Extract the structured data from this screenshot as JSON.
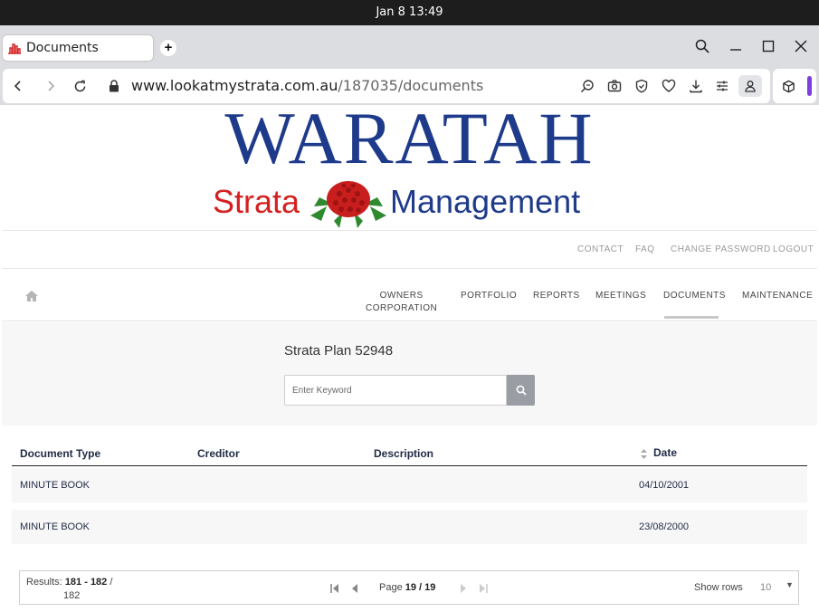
{
  "os": {
    "clock": "Jan 8  13:49"
  },
  "browser": {
    "tab_title": "Documents",
    "url_host": "www.lookatmystrata.com.au",
    "url_path": "/187035/documents"
  },
  "site": {
    "logo": {
      "title": "WARATAH",
      "line_left": "Strata",
      "line_right": "Management"
    },
    "top_links": [
      "CONTACT",
      "FAQ",
      "CHANGE PASSWORD",
      "LOGOUT"
    ],
    "nav": {
      "owners_line1": "OWNERS",
      "owners_line2": "CORPORATION",
      "portfolio": "PORTFOLIO",
      "reports": "REPORTS",
      "meetings": "MEETINGS",
      "documents": "DOCUMENTS",
      "maintenance": "MAINTENANCE",
      "active": "DOCUMENTS"
    },
    "plan_title": "Strata Plan 52948",
    "search": {
      "placeholder": "Enter Keyword",
      "value": ""
    },
    "table": {
      "headers": {
        "type": "Document Type",
        "creditor": "Creditor",
        "description": "Description",
        "date": "Date"
      },
      "rows": [
        {
          "type": "MINUTE BOOK",
          "creditor": "",
          "description": "",
          "date": "04/10/2001"
        },
        {
          "type": "MINUTE BOOK",
          "creditor": "",
          "description": "",
          "date": "23/08/2000"
        }
      ]
    },
    "pager": {
      "results_label": "Results:",
      "range": "181 - 182",
      "sep": "/",
      "total": "182",
      "page_label": "Page",
      "page_current": "19 / 19",
      "show_rows_label": "Show rows",
      "rows_value": "10"
    }
  },
  "colors": {
    "brand_blue": "#1e3a8a",
    "brand_red": "#d42020",
    "search_button": "#9a9ea4"
  }
}
